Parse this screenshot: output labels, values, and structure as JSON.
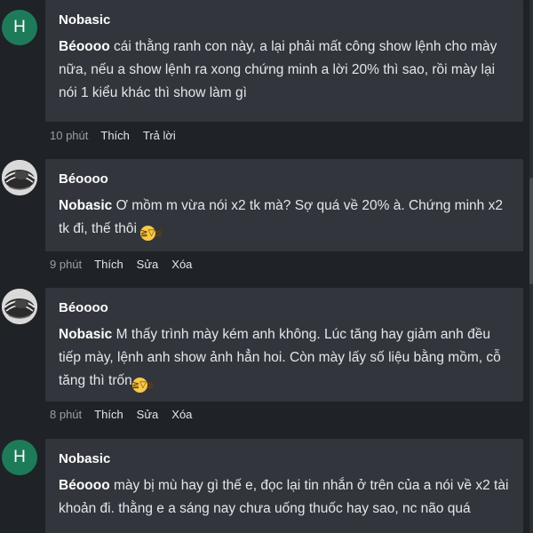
{
  "comments": [
    {
      "avatar_letter": "H",
      "author": "Nobasic",
      "mention": "Béoooo",
      "text": " cái thằng ranh con này, a lại phải mất công show lệnh cho mày nữa, nếu a show lệnh ra xong chứng minh a lời 20% thì sao, rồi mày lại nói 1 kiểu khác thì show làm gì",
      "time": "10 phút",
      "actions": [
        "Thích",
        "Trả lời"
      ]
    },
    {
      "avatar_icon": "user-photo",
      "author": "Béoooo",
      "mention": "Nobasic",
      "text": " Ơ mồm m vừa nói x2 tk mà? Sợ quá về 20% à. Chứng minh x2 tk đi, thế thôi ",
      "emoji_icon": "grinning-squint-emoji",
      "time": "9 phút",
      "actions": [
        "Thích",
        "Sửa",
        "Xóa"
      ]
    },
    {
      "avatar_icon": "user-photo",
      "author": "Béoooo",
      "mention": "Nobasic",
      "text": " M thấy trình mày kém anh không. Lúc tăng hay giảm anh đều tiếp mày, lệnh anh show ảnh hẳn hoi. Còn mày lấy số liệu bằng mồm, cỗ tăng thì trốn",
      "emoji_icon": "grinning-squint-emoji",
      "time": "8 phút",
      "actions": [
        "Thích",
        "Sửa",
        "Xóa"
      ]
    },
    {
      "avatar_letter": "H",
      "author": "Nobasic",
      "mention": "Béoooo",
      "text": " mày bị mù hay gì thế e, đọc lại tin nhắn ở trên của a nói về x2 tài khoản đi. thằng e a sáng nay chưa uống thuốc hay sao, nc não quá"
    }
  ],
  "colors": {
    "background": "#1f2226",
    "bubble": "#32363c",
    "letter_avatar": "#1e7b5a",
    "emoji": "#f7c948"
  }
}
